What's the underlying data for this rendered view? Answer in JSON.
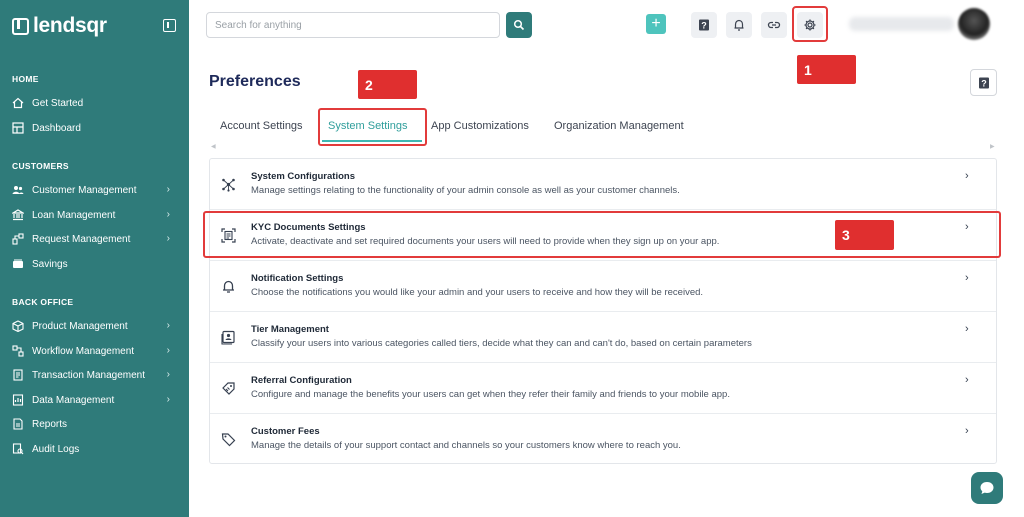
{
  "brand": {
    "name": "lendsqr"
  },
  "sidebar": {
    "sections": [
      {
        "title": "HOME",
        "items": [
          {
            "label": "Get Started",
            "icon": "home-icon",
            "has_children": false
          },
          {
            "label": "Dashboard",
            "icon": "dashboard-icon",
            "has_children": false
          }
        ]
      },
      {
        "title": "CUSTOMERS",
        "items": [
          {
            "label": "Customer Management",
            "icon": "users-icon",
            "has_children": true
          },
          {
            "label": "Loan Management",
            "icon": "bank-icon",
            "has_children": true
          },
          {
            "label": "Request Management",
            "icon": "request-icon",
            "has_children": true
          },
          {
            "label": "Savings",
            "icon": "savings-icon",
            "has_children": false
          }
        ]
      },
      {
        "title": "BACK OFFICE",
        "items": [
          {
            "label": "Product Management",
            "icon": "product-icon",
            "has_children": true
          },
          {
            "label": "Workflow Management",
            "icon": "workflow-icon",
            "has_children": true
          },
          {
            "label": "Transaction Management",
            "icon": "transaction-icon",
            "has_children": true
          },
          {
            "label": "Data Management",
            "icon": "data-icon",
            "has_children": true
          },
          {
            "label": "Reports",
            "icon": "reports-icon",
            "has_children": false
          },
          {
            "label": "Audit Logs",
            "icon": "audit-icon",
            "has_children": false
          }
        ]
      }
    ]
  },
  "topbar": {
    "search_placeholder": "Search for anything",
    "add_label": "+"
  },
  "annotations": {
    "callout_1": "1",
    "callout_2": "2",
    "callout_3": "3"
  },
  "page": {
    "title": "Preferences",
    "tabs": [
      {
        "label": "Account Settings",
        "active": false
      },
      {
        "label": "System Settings",
        "active": true
      },
      {
        "label": "App Customizations",
        "active": false
      },
      {
        "label": "Organization Management",
        "active": false
      }
    ],
    "settings": [
      {
        "title": "System Configurations",
        "description": "Manage settings relating to the functionality of your admin console as well as your customer channels.",
        "icon": "network-icon"
      },
      {
        "title": "KYC Documents Settings",
        "description": "Activate, deactivate and set required documents your users will need to provide when they sign up on your app.",
        "icon": "document-scan-icon"
      },
      {
        "title": "Notification Settings",
        "description": "Choose the notifications you would like your admin and your users to receive and how they will be received.",
        "icon": "bell-icon"
      },
      {
        "title": "Tier Management",
        "description": "Classify your users into various categories called tiers, decide what they can and can't do, based on certain parameters",
        "icon": "id-card-icon"
      },
      {
        "title": "Referral Configuration",
        "description": "Configure and manage the benefits your users can get when they refer their family and friends to your mobile app.",
        "icon": "referral-icon"
      },
      {
        "title": "Customer Fees",
        "description": "Manage the details of your support contact and channels so your customers know where to reach you.",
        "icon": "tag-icon"
      }
    ]
  },
  "colors": {
    "sidebar": "#2f7b7a",
    "accent": "#3fb7b2",
    "annotation": "#e23b3b"
  }
}
